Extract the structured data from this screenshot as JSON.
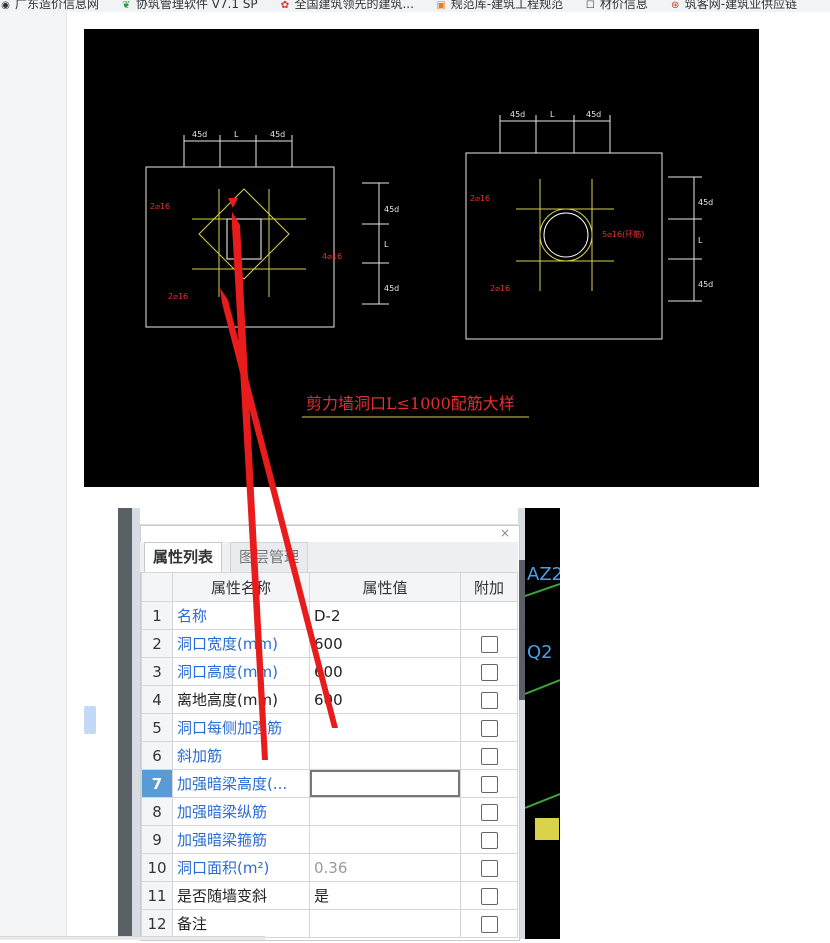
{
  "bookmarks": [
    {
      "icon": "globe-icon",
      "label": "广东造价信息网"
    },
    {
      "icon": "leaf-icon",
      "label": "协筑管理软件 V7.1 SP"
    },
    {
      "icon": "flower-icon",
      "label": "全国建筑领先的建筑..."
    },
    {
      "icon": "book-icon",
      "label": "规范库-建筑工程规范"
    },
    {
      "icon": "page-icon",
      "label": "材价信息"
    },
    {
      "icon": "zhu-icon",
      "label": "筑客网-建筑业供应链"
    }
  ],
  "cad": {
    "title": "剪力墙洞口L≤1000配筋大样",
    "dim_45d": "45d",
    "dim_L": "L",
    "label_2c16": "2⌀16",
    "label_4c16": "4⌀16",
    "label_5c16": "5⌀16(环筋)"
  },
  "panel": {
    "close": "×",
    "tabs": [
      "属性列表",
      "图层管理"
    ],
    "headers": {
      "name": "属性名称",
      "value": "属性值",
      "extra": "附加"
    },
    "rows": [
      {
        "idx": "1",
        "name": "名称",
        "value": "D-2"
      },
      {
        "idx": "2",
        "name": "洞口宽度(mm)",
        "value": "600"
      },
      {
        "idx": "3",
        "name": "洞口高度(mm)",
        "value": "600"
      },
      {
        "idx": "4",
        "name": "离地高度(mm)",
        "value": "600"
      },
      {
        "idx": "5",
        "name": "洞口每侧加强筋",
        "value": ""
      },
      {
        "idx": "6",
        "name": "斜加筋",
        "value": ""
      },
      {
        "idx": "7",
        "name": "加强暗梁高度(...",
        "value": ""
      },
      {
        "idx": "8",
        "name": "加强暗梁纵筋",
        "value": ""
      },
      {
        "idx": "9",
        "name": "加强暗梁箍筋",
        "value": ""
      },
      {
        "idx": "10",
        "name": "洞口面积(m²)",
        "value": "0.36"
      },
      {
        "idx": "11",
        "name": "是否随墙变斜",
        "value": "是"
      },
      {
        "idx": "12",
        "name": "备注",
        "value": ""
      }
    ]
  },
  "cad_right_fragments": {
    "a": "AZ2",
    "b": "Q2"
  }
}
